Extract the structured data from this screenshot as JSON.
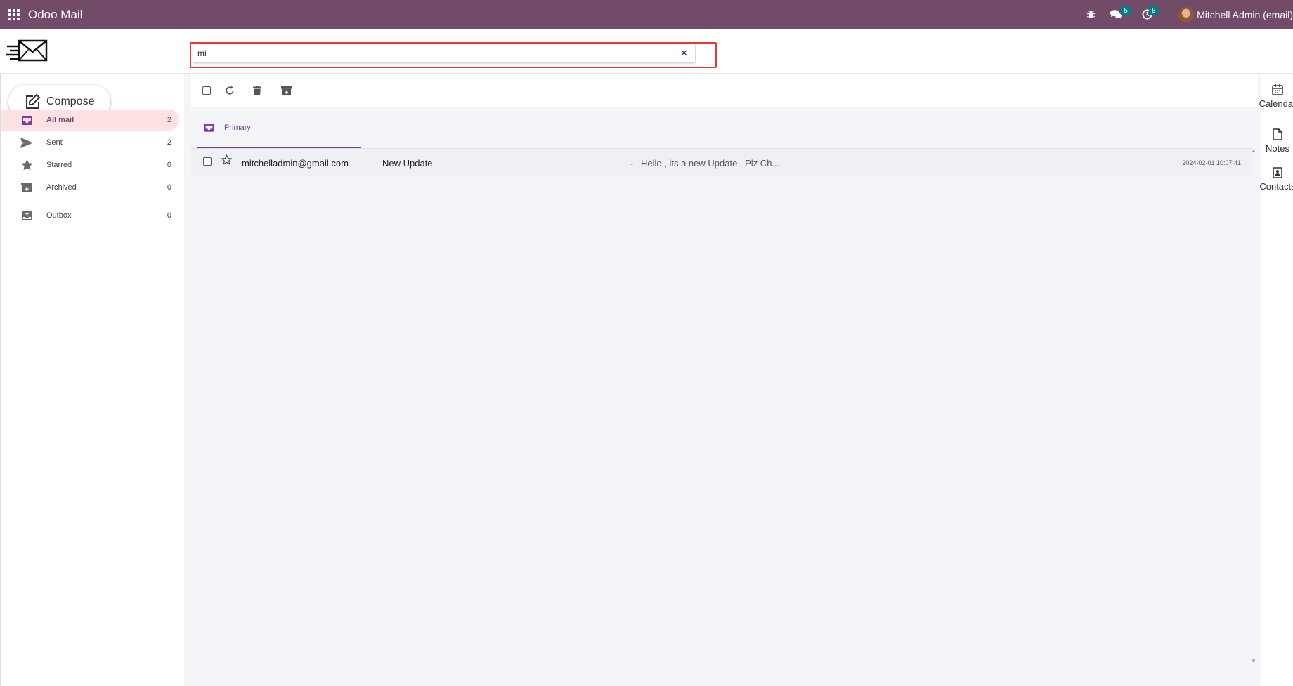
{
  "navbar": {
    "app_title": "Odoo Mail",
    "chat_badge": "5",
    "activity_badge": "8",
    "user_name": "Mitchell Admin (email)",
    "brand_color": "#714B67"
  },
  "search": {
    "value": "mi",
    "placeholder": ""
  },
  "compose": {
    "label": "Compose"
  },
  "folders": [
    {
      "label": "All mail",
      "count": "2",
      "icon": "inbox-icon",
      "active": true
    },
    {
      "label": "Sent",
      "count": "2",
      "icon": "send-icon",
      "active": false
    },
    {
      "label": "Starred",
      "count": "0",
      "icon": "star-icon",
      "active": false
    },
    {
      "label": "Archived",
      "count": "0",
      "icon": "archive-icon",
      "active": false
    },
    {
      "label": "Outbox",
      "count": "0",
      "icon": "outbox-icon",
      "active": false
    }
  ],
  "tabs": [
    {
      "label": "Primary",
      "active": true
    }
  ],
  "mails": [
    {
      "from": "mitchelladmin@gmail.com",
      "subject": "New Update",
      "separator": "-",
      "preview": "Hello , its a new Update . Plz Ch...",
      "date": "2024-02-01 10:07:41"
    }
  ],
  "right_panel": [
    {
      "label": "Calendar",
      "icon": "calendar-icon"
    },
    {
      "label": "Notes",
      "icon": "note-icon"
    },
    {
      "label": "Contacts",
      "icon": "contact-icon"
    }
  ]
}
